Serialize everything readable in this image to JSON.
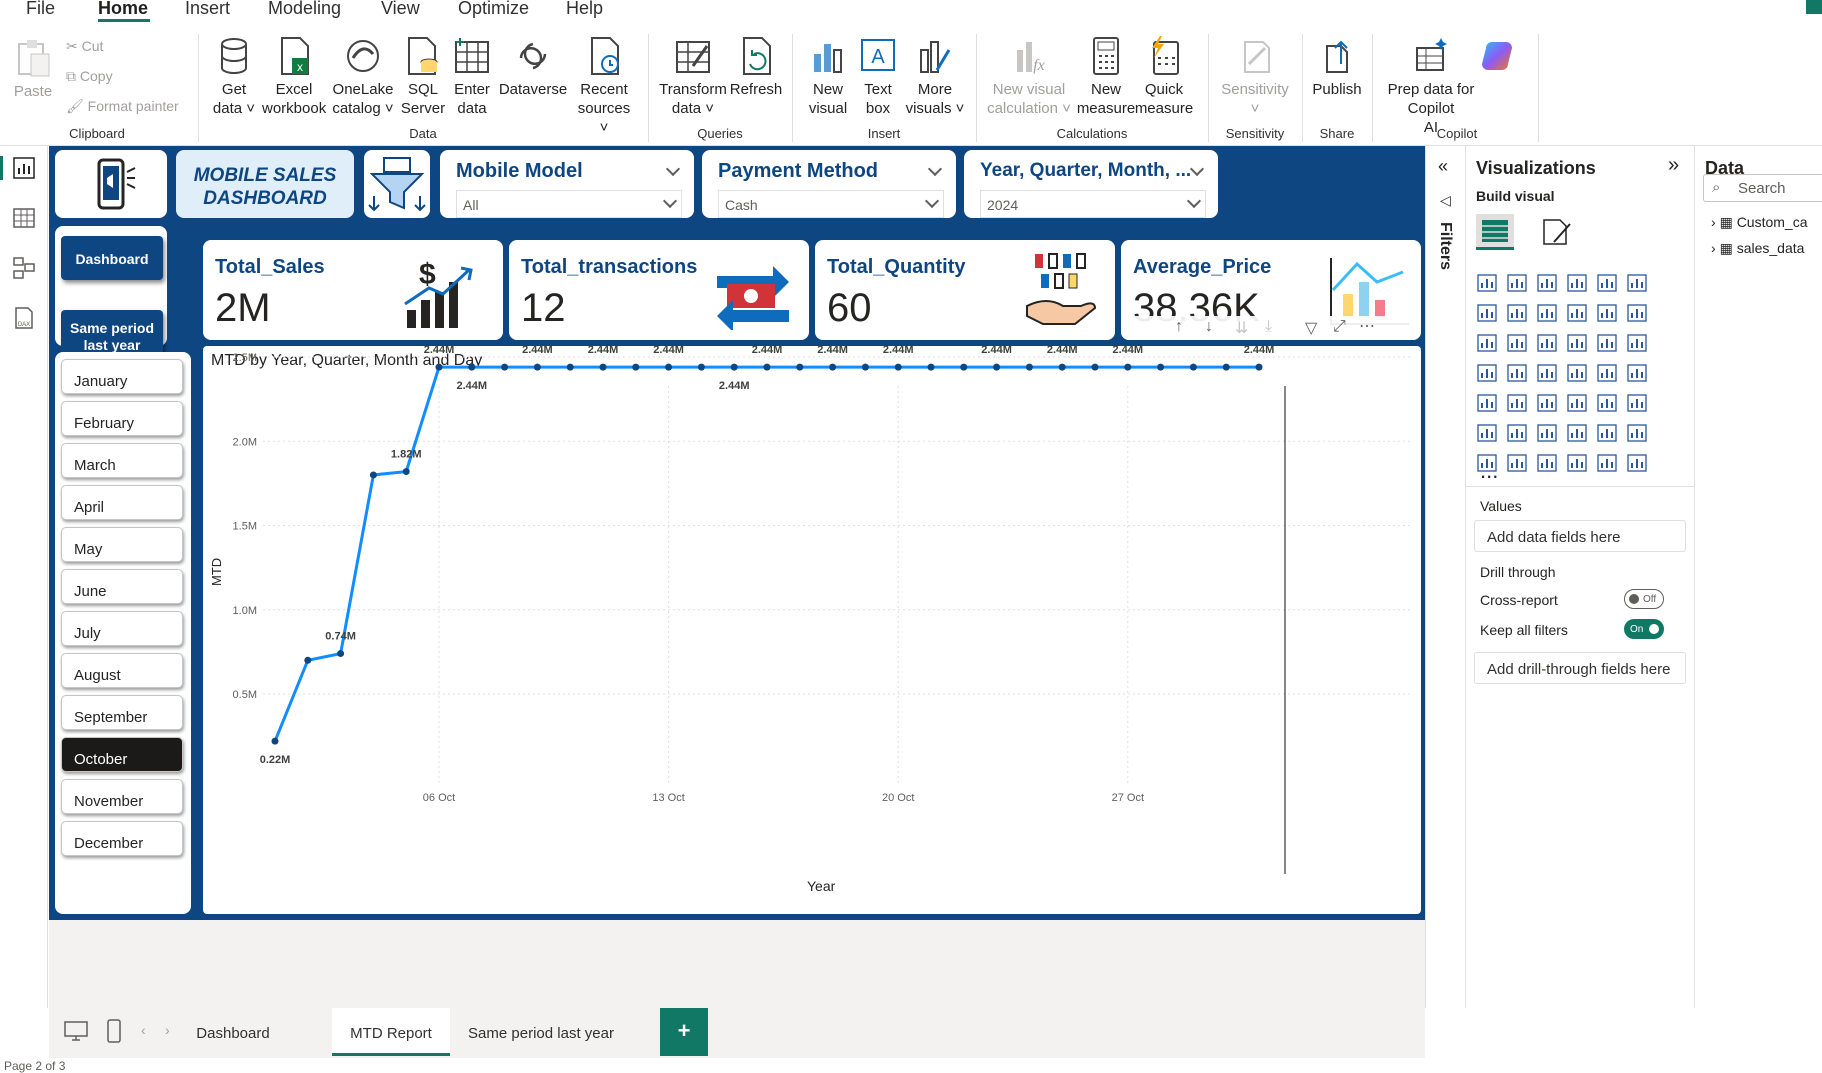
{
  "menu": {
    "items": [
      "File",
      "Home",
      "Insert",
      "Modeling",
      "View",
      "Optimize",
      "Help"
    ],
    "active": "Home"
  },
  "ribbon": {
    "clipboard": {
      "paste": "Paste",
      "cut": "Cut",
      "copy": "Copy",
      "format_painter": "Format painter",
      "group": "Clipboard"
    },
    "data": {
      "get_data": [
        "Get",
        "data"
      ],
      "excel": [
        "Excel",
        "workbook"
      ],
      "onelake": [
        "OneLake",
        "catalog"
      ],
      "sql": [
        "SQL",
        "Server"
      ],
      "enter": [
        "Enter",
        "data"
      ],
      "dataverse": "Dataverse",
      "recent": [
        "Recent",
        "sources"
      ],
      "group": "Data"
    },
    "queries": {
      "transform": [
        "Transform",
        "data"
      ],
      "refresh": "Refresh",
      "group": "Queries"
    },
    "insert": {
      "new_visual": [
        "New",
        "visual"
      ],
      "text_box": [
        "Text",
        "box"
      ],
      "more_visuals": [
        "More",
        "visuals"
      ],
      "group": "Insert"
    },
    "calculations": {
      "new_visual_calc": [
        "New visual",
        "calculation"
      ],
      "new_measure": [
        "New",
        "measure"
      ],
      "quick_measure": [
        "Quick",
        "measure"
      ],
      "group": "Calculations"
    },
    "sensitivity": {
      "label": "Sensitivity",
      "group": "Sensitivity"
    },
    "share": {
      "publish": "Publish",
      "group": "Share"
    },
    "copilot": {
      "prep": [
        "Prep data for Copilot",
        "AI"
      ],
      "group": "Copilot"
    }
  },
  "report": {
    "title_line1": "MOBILE SALES",
    "title_line2": "DASHBOARD",
    "nav": {
      "dashboard": "Dashboard",
      "same_period_1": "Same period",
      "same_period_2": "last year"
    },
    "months": [
      "January",
      "February",
      "March",
      "April",
      "May",
      "June",
      "July",
      "August",
      "September",
      "October",
      "November",
      "December"
    ],
    "selected_month": "October",
    "slicers": [
      {
        "title": "Mobile Model",
        "value": "All"
      },
      {
        "title": "Payment Method",
        "value": "Cash"
      },
      {
        "title": "Year, Quarter, Month, ...",
        "value": "2024"
      }
    ],
    "kpis": [
      {
        "title": "Total_Sales",
        "value": "2M"
      },
      {
        "title": "Total_transactions",
        "value": "12"
      },
      {
        "title": "Total_Quantity",
        "value": "60"
      },
      {
        "title": "Average_Price",
        "value": "38.36K"
      }
    ]
  },
  "chart_data": {
    "type": "line",
    "title": "MTD by Year, Quarter, Month and Day",
    "xlabel": "Year",
    "ylabel": "MTD",
    "y_ticks": [
      "0.5M",
      "1.0M",
      "1.5M",
      "2.0M",
      "2.5M"
    ],
    "x_ticks": [
      "06 Oct",
      "13 Oct",
      "20 Oct",
      "27 Oct"
    ],
    "ylim": [
      0.2,
      2.5
    ],
    "x": [
      "2024-10-01",
      "2024-10-02",
      "2024-10-03",
      "2024-10-04",
      "2024-10-05",
      "2024-10-06",
      "2024-10-07",
      "2024-10-08",
      "2024-10-09",
      "2024-10-10",
      "2024-10-11",
      "2024-10-12",
      "2024-10-13",
      "2024-10-14",
      "2024-10-15",
      "2024-10-16",
      "2024-10-17",
      "2024-10-18",
      "2024-10-19",
      "2024-10-20",
      "2024-10-21",
      "2024-10-22",
      "2024-10-23",
      "2024-10-24",
      "2024-10-25",
      "2024-10-26",
      "2024-10-27",
      "2024-10-28",
      "2024-10-29",
      "2024-10-30",
      "2024-10-31"
    ],
    "values": [
      0.22,
      0.7,
      0.74,
      1.8,
      1.82,
      2.44,
      2.44,
      2.44,
      2.44,
      2.44,
      2.44,
      2.44,
      2.44,
      2.44,
      2.44,
      2.44,
      2.44,
      2.44,
      2.44,
      2.44,
      2.44,
      2.44,
      2.44,
      2.44,
      2.44,
      2.44,
      2.44,
      2.44,
      2.44,
      2.44,
      2.44
    ],
    "labels": [
      {
        "i": 0,
        "text": "0.22M",
        "pos": "below"
      },
      {
        "i": 2,
        "text": "0.74M",
        "pos": "above"
      },
      {
        "i": 4,
        "text": "1.82M",
        "pos": "above"
      },
      {
        "i": 5,
        "text": "2.44M",
        "pos": "above"
      },
      {
        "i": 6,
        "text": "2.44M",
        "pos": "below"
      },
      {
        "i": 8,
        "text": "2.44M",
        "pos": "above"
      },
      {
        "i": 10,
        "text": "2.44M",
        "pos": "above"
      },
      {
        "i": 12,
        "text": "2.44M",
        "pos": "above"
      },
      {
        "i": 14,
        "text": "2.44M",
        "pos": "below"
      },
      {
        "i": 15,
        "text": "2.44M",
        "pos": "above"
      },
      {
        "i": 17,
        "text": "2.44M",
        "pos": "above"
      },
      {
        "i": 19,
        "text": "2.44M",
        "pos": "above"
      },
      {
        "i": 22,
        "text": "2.44M",
        "pos": "above"
      },
      {
        "i": 24,
        "text": "2.44M",
        "pos": "above"
      },
      {
        "i": 26,
        "text": "2.44M",
        "pos": "above"
      },
      {
        "i": 30,
        "text": "2.44M",
        "pos": "above"
      }
    ],
    "line_color": "#118dff",
    "grid": true
  },
  "filters_pane": {
    "label": "Filters"
  },
  "visualizations": {
    "title": "Visualizations",
    "build_visual": "Build visual",
    "values_label": "Values",
    "add_data_fields": "Add data fields here",
    "drill_through": "Drill through",
    "cross_report": "Cross-report",
    "cross_report_state": "Off",
    "keep_all_filters": "Keep all filters",
    "keep_all_filters_state": "On",
    "add_drill_fields": "Add drill-through fields here",
    "more": "..."
  },
  "data_pane": {
    "title": "Data",
    "search_placeholder": "Search",
    "tables": [
      "Custom_ca",
      "sales_data"
    ]
  },
  "tabs": {
    "items": [
      "Dashboard",
      "MTD Report",
      "Same period last year"
    ],
    "active": "MTD Report",
    "add": "+"
  },
  "status": {
    "page": "Page 2 of 3"
  },
  "colors": {
    "accent": "#117865",
    "report_bg": "#0e4682",
    "line": "#118dff"
  }
}
